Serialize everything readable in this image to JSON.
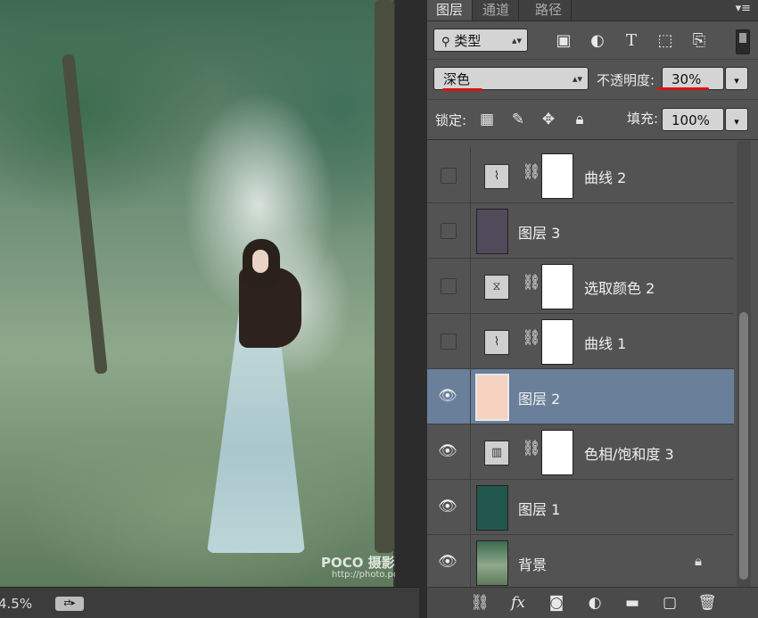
{
  "canvas": {
    "zoom": "4.5%",
    "watermark_logo": "POCO 摄影专题",
    "watermark_url": "http://photo.poco.cn/"
  },
  "panel": {
    "tabs": [
      {
        "label": "图层",
        "active": true
      },
      {
        "label": "通道",
        "active": false
      },
      {
        "label": "路径",
        "active": false
      }
    ],
    "menu_icon": "panel-menu-icon",
    "filter": {
      "label": "类型",
      "icon": "search-icon"
    },
    "filter_icons": [
      "image-filter-icon",
      "adjustment-filter-icon",
      "type-filter-icon",
      "shape-filter-icon",
      "smart-object-filter-icon"
    ],
    "blend_mode": "深色",
    "opacity_label": "不透明度:",
    "opacity_value": "30%",
    "lock_label": "锁定:",
    "lock_icons": [
      "lock-transparent-icon",
      "lock-image-icon",
      "lock-position-icon",
      "lock-all-icon"
    ],
    "fill_label": "填充:",
    "fill_value": "100%",
    "layers": [
      {
        "name": "曲线 2",
        "type": "curves",
        "visible": false,
        "selected": false,
        "has_mask": true
      },
      {
        "name": "图层 3",
        "type": "fill",
        "color": "#4f4b5a",
        "visible": false,
        "selected": false,
        "has_mask": false
      },
      {
        "name": "选取颜色 2",
        "type": "selective-color",
        "visible": false,
        "selected": false,
        "has_mask": true
      },
      {
        "name": "曲线 1",
        "type": "curves",
        "visible": false,
        "selected": false,
        "has_mask": true
      },
      {
        "name": "图层 2",
        "type": "fill",
        "color": "#f6d3c1",
        "visible": true,
        "selected": true,
        "has_mask": false
      },
      {
        "name": "色相/饱和度 3",
        "type": "hue-saturation",
        "visible": true,
        "selected": false,
        "has_mask": true
      },
      {
        "name": "图层 1",
        "type": "fill",
        "color": "#22574f",
        "visible": true,
        "selected": false,
        "has_mask": false
      },
      {
        "name": "背景",
        "type": "background",
        "visible": true,
        "selected": false,
        "has_mask": false,
        "locked": true
      }
    ],
    "bottom_icons": [
      "link-layers-icon",
      "fx-icon",
      "add-mask-icon",
      "new-adjustment-icon",
      "new-group-icon",
      "new-layer-icon",
      "delete-layer-icon"
    ],
    "selection_color": "#6a7f99",
    "annotation_color": "#dd1111"
  }
}
